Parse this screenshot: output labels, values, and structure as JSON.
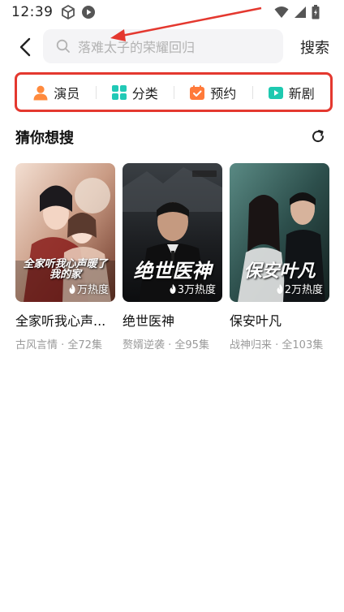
{
  "status_bar": {
    "time": "12:39",
    "left_icons": [
      "cube-icon",
      "play-circle-icon"
    ],
    "right_icons": [
      "wifi-icon",
      "signal-icon",
      "battery-icon"
    ]
  },
  "search": {
    "placeholder": "落难太子的荣耀回归",
    "submit_label": "搜索"
  },
  "quick_nav": {
    "highlight_color": "#e4382f",
    "items": [
      {
        "label": "演员",
        "icon": "person-icon",
        "color": "#ff8a3d"
      },
      {
        "label": "分类",
        "icon": "grid-icon",
        "color": "#21c9b6"
      },
      {
        "label": "预约",
        "icon": "calendar-icon",
        "color": "#ff7a3a"
      },
      {
        "label": "新剧",
        "icon": "tv-play-icon",
        "color": "#1ec9b0"
      }
    ]
  },
  "section": {
    "title": "猜你想搜",
    "refresh_icon": "refresh-icon"
  },
  "cards": [
    {
      "poster_title": "全家听我心声暖了 我的家",
      "heat": "万热度",
      "name": "全家听我心声...",
      "meta": "古风言情 · 全72集"
    },
    {
      "poster_title": "绝世医神",
      "heat": "3万热度",
      "name": "绝世医神",
      "meta": "赘婿逆袭 · 全95集"
    },
    {
      "poster_title": "保安叶凡",
      "heat": "2万热度",
      "name": "保安叶凡",
      "meta": "战神归来 · 全103集"
    }
  ]
}
